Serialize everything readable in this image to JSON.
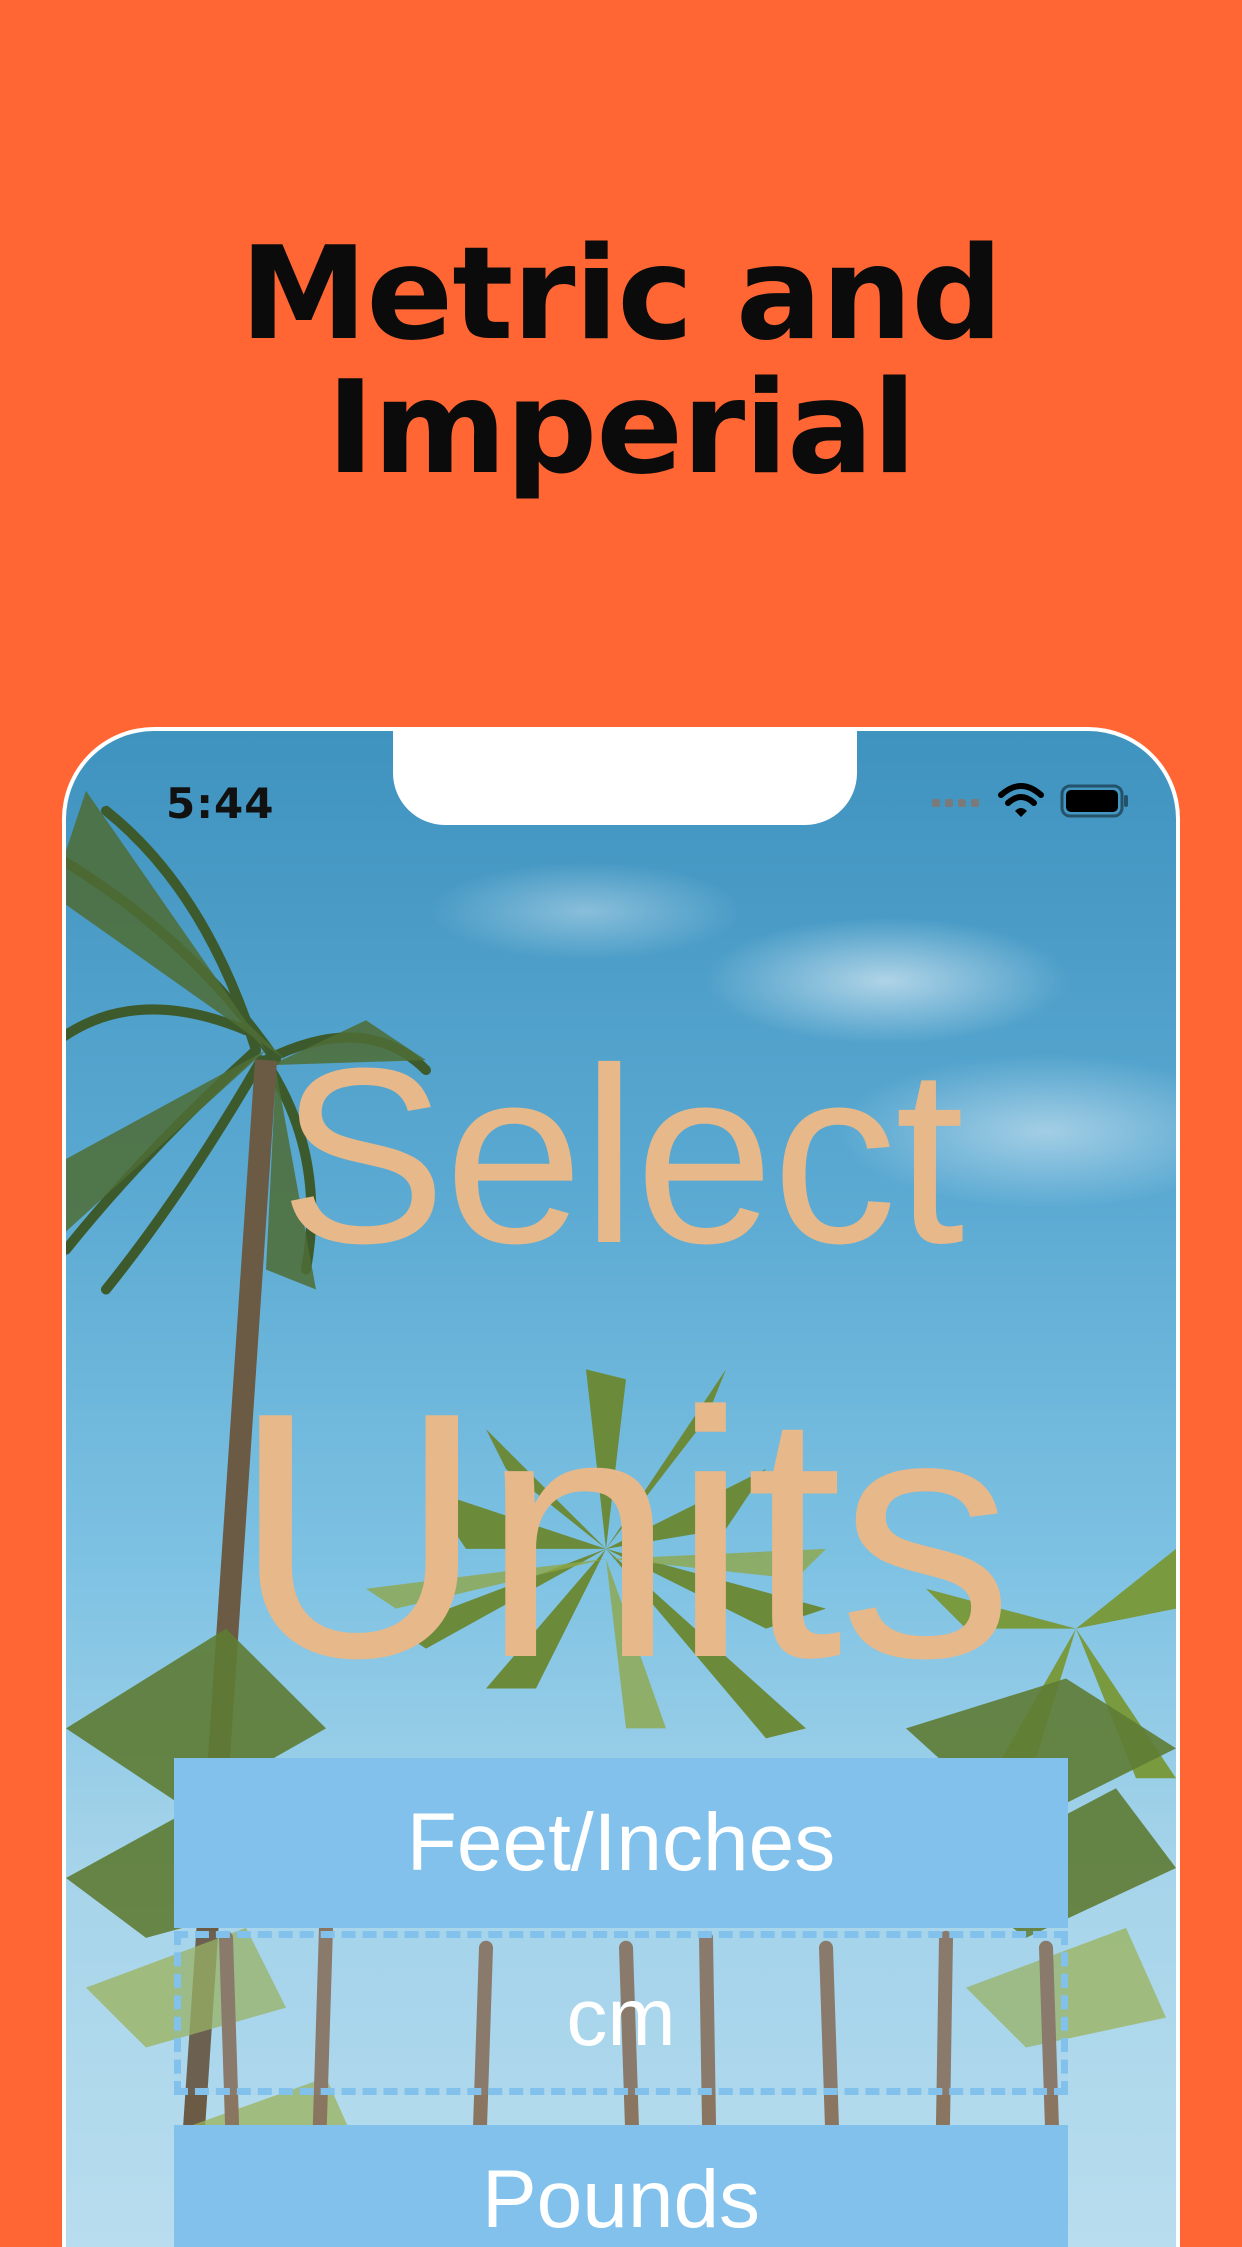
{
  "headline": {
    "line1": "Metric and",
    "line2": "Imperial"
  },
  "status_bar": {
    "time": "5:44",
    "icons": [
      "signal-dots-icon",
      "wifi-icon",
      "battery-icon"
    ]
  },
  "main": {
    "title_line1": "Select",
    "title_line2": "Units"
  },
  "options": {
    "feet_inches": "Feet/Inches",
    "cm": "cm",
    "pounds": "Pounds"
  },
  "colors": {
    "background": "#ff6633",
    "title_text": "#e6b88a",
    "button_fill": "#82c1ec",
    "button_text": "#ffffff"
  }
}
